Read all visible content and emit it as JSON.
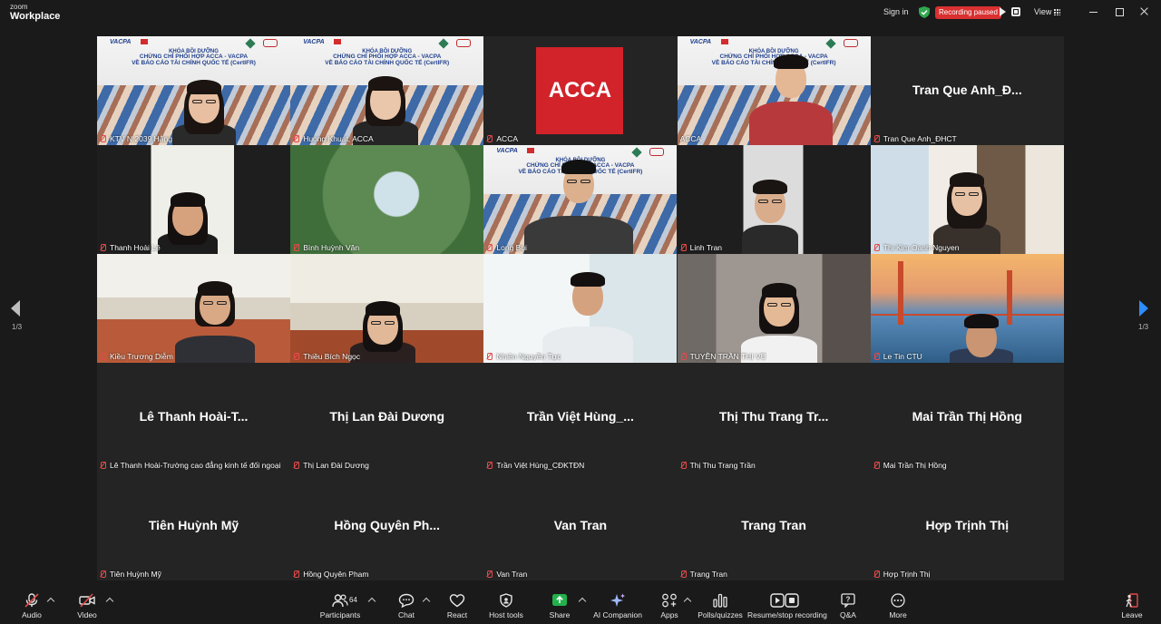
{
  "app": {
    "logo_line1": "zoom",
    "logo_line2": "Workplace",
    "sign_in": "Sign in",
    "recording_status": "Recording paused",
    "view": "View",
    "accent": "#2d8cff",
    "recording_color": "#d93030",
    "active_speaker_color": "#3fbf6a"
  },
  "banner": {
    "logo_text": "VACPA",
    "line1": "KHÓA BỒI DƯỠNG",
    "line2": "CHỨNG CHỈ PHỐI HỢP ACCA - VACPA",
    "line3": "VỀ BÁO CÁO TÀI CHÍNH QUỐC TẾ (CertIFR)"
  },
  "acca_logo_text": "ACCA",
  "participants": [
    {
      "name": "KTV N.2039 Hằng",
      "muted": true,
      "video": "banner-woman"
    },
    {
      "name": "Huong Khuat, ACCA",
      "muted": true,
      "video": "banner-woman2"
    },
    {
      "name": "ACCA",
      "muted": true,
      "video": "acca"
    },
    {
      "name": "ACCA",
      "muted": false,
      "video": "banner-man",
      "speaking": true
    },
    {
      "name": "Tran Que Anh_ĐHCT",
      "muted": true,
      "video": "off",
      "display": "Tran Que Anh_Đ..."
    },
    {
      "name": "Thanh Hoài Lê",
      "muted": true,
      "video": "room1"
    },
    {
      "name": "Bình Huỳnh Văn",
      "muted": true,
      "video": "green"
    },
    {
      "name": "Long Bui",
      "muted": true,
      "video": "banner-man2"
    },
    {
      "name": "Linh Tran",
      "muted": true,
      "video": "white"
    },
    {
      "name": "Thi Kim Oanh Nguyen",
      "muted": true,
      "video": "library"
    },
    {
      "name": "Kiều Trương Diễm",
      "muted": true,
      "video": "office"
    },
    {
      "name": "Thiều Bích Ngọc",
      "muted": true,
      "video": "office2"
    },
    {
      "name": "Nhiên Nguyễn Tực",
      "muted": true,
      "video": "bright"
    },
    {
      "name": "TUYỀN TRẦN THỊ VŨ",
      "muted": true,
      "video": "bedroom"
    },
    {
      "name": "Le Tin CTU",
      "muted": true,
      "video": "bridge"
    },
    {
      "name": "Lê Thanh Hoài-Trường cao đẳng kinh tế đối ngoại",
      "muted": true,
      "video": "off",
      "display": "Lê Thanh Hoài-T..."
    },
    {
      "name": "Thị Lan Đài Dương",
      "muted": true,
      "video": "off",
      "display": "Thị Lan Đài Dương"
    },
    {
      "name": "Trần Việt Hùng_CĐKTĐN",
      "muted": true,
      "video": "off",
      "display": "Trần Việt Hùng_..."
    },
    {
      "name": "Thị Thu Trang Trần",
      "muted": true,
      "video": "off",
      "display": "Thị Thu Trang Tr..."
    },
    {
      "name": "Mai Trần Thị Hồng",
      "muted": true,
      "video": "off",
      "display": "Mai Trần Thị Hồng"
    },
    {
      "name": "Tiên Huỳnh Mỹ",
      "muted": true,
      "video": "off",
      "display": "Tiên Huỳnh Mỹ"
    },
    {
      "name": "Hồng Quyên Pham",
      "muted": true,
      "video": "off",
      "display": "Hồng Quyên Ph..."
    },
    {
      "name": "Van Tran",
      "muted": true,
      "video": "off",
      "display": "Van Tran"
    },
    {
      "name": "Trang Tran",
      "muted": true,
      "video": "off",
      "display": "Trang Tran"
    },
    {
      "name": "Hợp Trịnh Thị",
      "muted": true,
      "video": "off",
      "display": "Hợp Trịnh Thị"
    }
  ],
  "pagination": {
    "left": "1/3",
    "right": "1/3"
  },
  "toolbar": {
    "audio": "Audio",
    "video": "Video",
    "participants": "Participants",
    "participant_count": "64",
    "chat": "Chat",
    "react": "React",
    "host_tools": "Host tools",
    "share": "Share",
    "ai_companion": "AI Companion",
    "apps": "Apps",
    "polls": "Polls/quizzes",
    "recording": "Resume/stop recording",
    "qa": "Q&A",
    "more": "More",
    "leave": "Leave"
  }
}
